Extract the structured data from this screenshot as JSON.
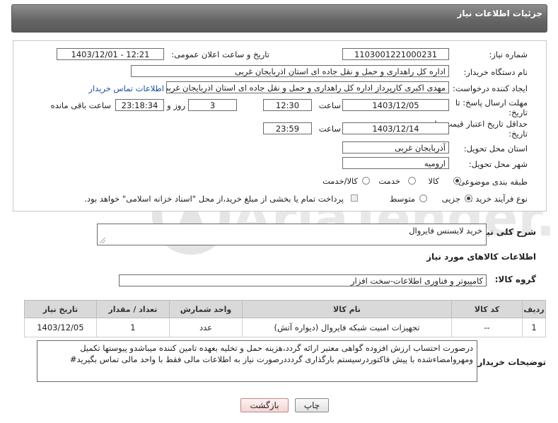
{
  "header": {
    "title": "جزئیات اطلاعات نیاز"
  },
  "form": {
    "need_number": {
      "label": "شماره نیاز:",
      "value": "1103001221000231"
    },
    "announce_datetime": {
      "label": "تاریخ و ساعت اعلان عمومی:",
      "value": "1403/12/01 - 12:21"
    },
    "buyer_org": {
      "label": "نام دستگاه خریدار:",
      "value": "اداره کل راهداری و حمل و نقل جاده ای استان اذربایجان غربی"
    },
    "requester": {
      "label": "ایجاد کننده درخواست:",
      "value": "مهدی اکبری کارپرداز اداره کل راهداری و حمل و نقل جاده ای استان اذربایجان غربی",
      "contact_link": "اطلاعات تماس خریدار"
    },
    "reply_deadline": {
      "label_line1": "مهلت ارسال پاسخ: تا",
      "label_line2": "تاریخ:",
      "date": "1403/12/05",
      "time_label": "ساعت",
      "time": "12:30",
      "days": "3",
      "days_label": "روز و",
      "remaining": "23:18:34",
      "remaining_label": "ساعت باقی مانده"
    },
    "price_validity": {
      "label_line1": "حداقل تاریخ اعتبار قیمت: تا",
      "label_line2": "تاریخ:",
      "date": "1403/12/14",
      "time_label": "ساعت",
      "time": "23:59"
    },
    "delivery_province": {
      "label": "استان محل تحویل:",
      "value": "آذربایجان غربی"
    },
    "delivery_city": {
      "label": "شهر محل تحویل:",
      "value": "ارومیه"
    },
    "subject_category": {
      "label": "طبقه بندی موضوعی:",
      "options": [
        "کالا",
        "خدمت",
        "کالا/خدمت"
      ],
      "selected": "کالا"
    },
    "purchase_process": {
      "label": "نوع فرآیند خرید :",
      "options": [
        "جزیی",
        "متوسط"
      ],
      "selected": "جزیی",
      "note": "پرداخت تمام یا بخشی از مبلغ خرید،از محل \"اسناد خزانه اسلامی\" خواهد بود."
    }
  },
  "description": {
    "label": "شرح کلی نیاز:",
    "value": "خرید لایسنس فایروال"
  },
  "goods_info_title": "اطلاعات کالاهای مورد نیاز",
  "goods_group": {
    "label": "گروه کالا:",
    "value": "کامپیوتر و فناوری اطلاعات-سخت افزار"
  },
  "table": {
    "headers": [
      "ردیف",
      "کد کالا",
      "نام کالا",
      "واحد شمارش",
      "تعداد / مقدار",
      "تاریخ نیاز"
    ],
    "rows": [
      [
        "1",
        "--",
        "تجهیزات امنیت شبکه فایروال (دیواره آتش)",
        "عدد",
        "1",
        "1403/12/05"
      ]
    ]
  },
  "buyer_notes": {
    "label": "توضیحات خریدار:",
    "value": "درصورت احتساب ارزش افزوده گواهی معتبر ارائه گردد،هزینه حمل و تخلیه بعهده تامین کننده میباشدو پیوستها تکمیل ومهروامضاءشده با پیش فاکتوردرسیستم بارگذاری گردددرصورت نیاز به اطلاعات مالی فقط با واحد مالی تماس بگیرید#"
  },
  "buttons": {
    "print": "چاپ",
    "back": "بازگشت"
  },
  "watermark": {
    "text": "AriaTender.neT"
  },
  "colors": {
    "header_bg": "#6e6e6e",
    "link": "#1a4fa0",
    "watermark": "#e6e6e6"
  }
}
